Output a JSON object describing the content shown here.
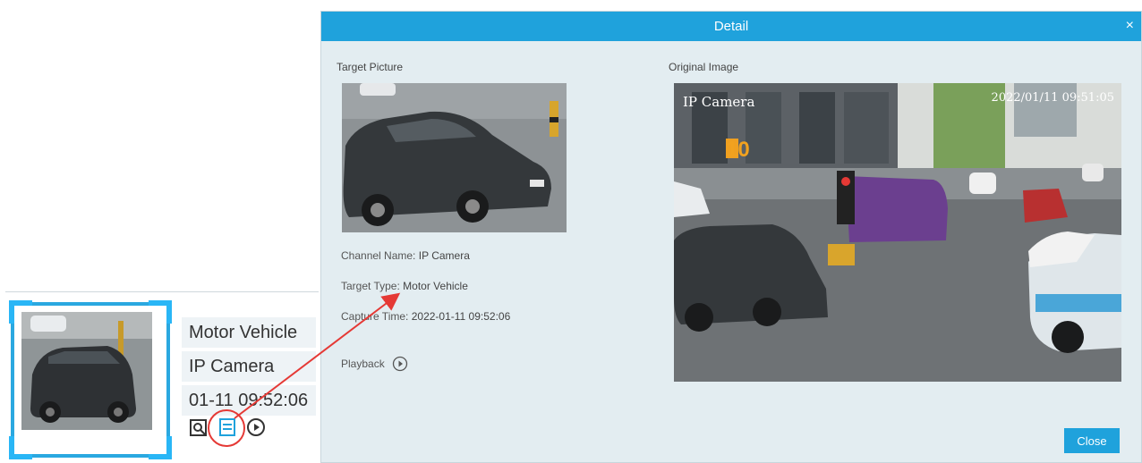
{
  "card": {
    "target_type": "Motor Vehicle",
    "channel_name": "IP Camera",
    "capture_time": "01-11 09:52:06",
    "actions": [
      {
        "icon": "zoom-image-icon"
      },
      {
        "icon": "detail-icon"
      },
      {
        "icon": "playback-icon"
      }
    ]
  },
  "dialog": {
    "title": "Detail",
    "close_glyph": "×",
    "target_picture_label": "Target Picture",
    "original_image_label": "Original Image",
    "channel_name_label": "Channel Name:",
    "channel_name_value": "IP Camera",
    "target_type_label": "Target Type:",
    "target_type_value": "Motor Vehicle",
    "capture_time_label": "Capture Time:",
    "capture_time_value": "2022-01-11 09:52:06",
    "playback_label": "Playback",
    "close_button": "Close",
    "osd_camera": "IP Camera",
    "osd_timestamp": "2022/01/11 09:51:05"
  },
  "colors": {
    "accent": "#1fa2dc",
    "highlight": "#e53935",
    "panel_bg": "#e3edf1"
  }
}
